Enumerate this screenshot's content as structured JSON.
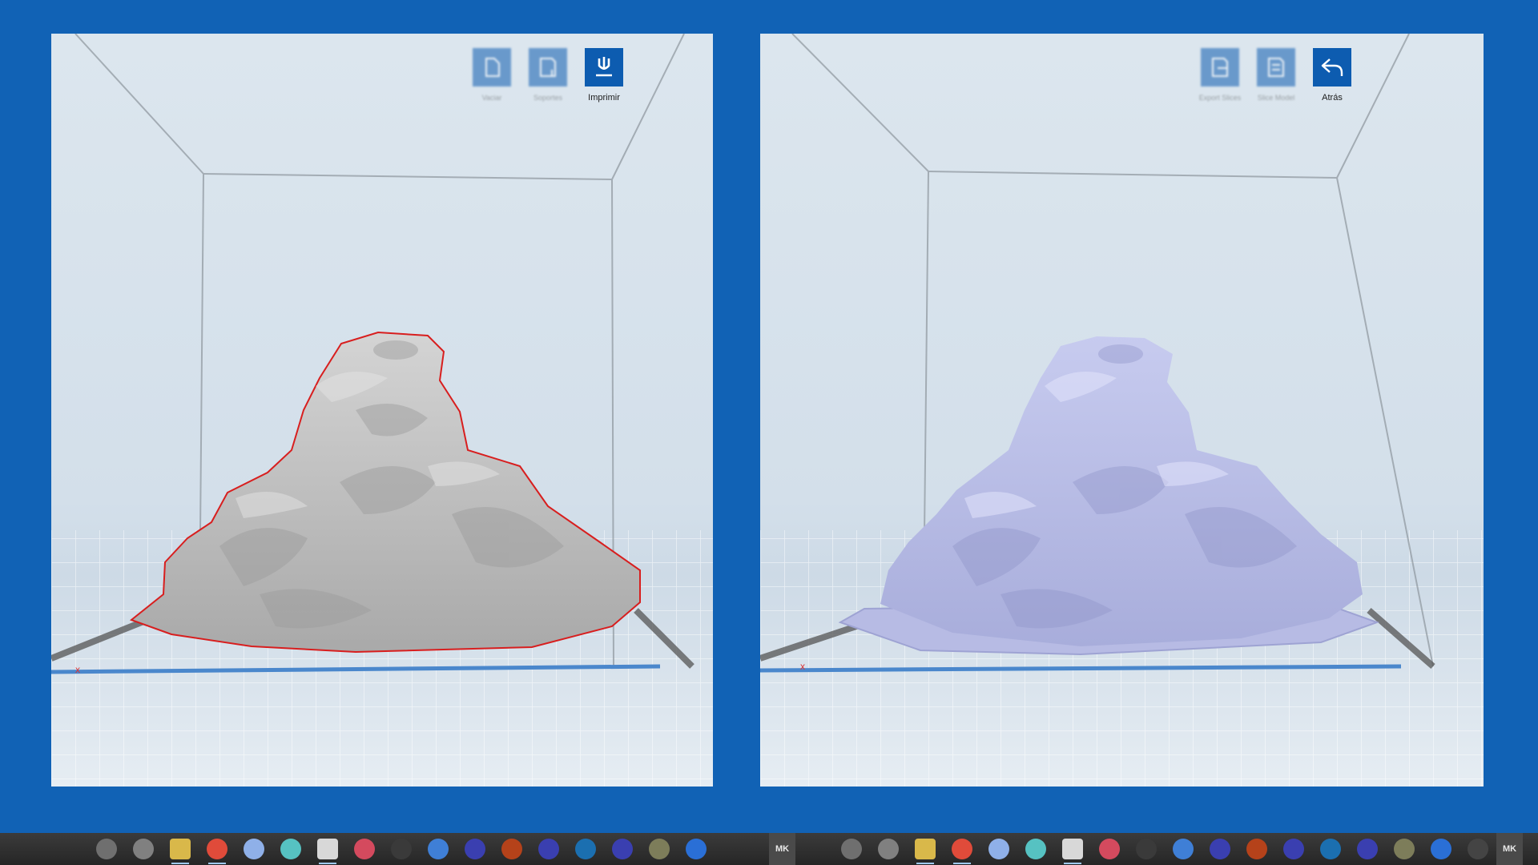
{
  "left_view": {
    "toolbar": [
      {
        "label": "Vaciar",
        "icon": "hollow-icon",
        "faded": true
      },
      {
        "label": "Soportes",
        "icon": "supports-icon",
        "faded": true
      },
      {
        "label": "Imprimir",
        "icon": "print-icon",
        "faded": false
      }
    ],
    "model_color": "#c4c4c4",
    "outline_color": "#d81e1e"
  },
  "right_view": {
    "toolbar": [
      {
        "label": "Export Slices",
        "icon": "export-slices-icon",
        "faded": true
      },
      {
        "label": "Slice Model",
        "icon": "slice-model-icon",
        "faded": true
      },
      {
        "label": "Atrás",
        "icon": "back-arrow-icon",
        "faded": false
      }
    ],
    "model_color": "#b9bde6"
  },
  "taskbar": {
    "left_icons": [
      "app-icon",
      "app-icon",
      "folder-icon",
      "chrome-icon",
      "app-icon",
      "app-icon",
      "notepad-icon",
      "app-icon",
      "app-icon",
      "app-icon",
      "app-icon",
      "app-icon",
      "app-icon",
      "app-icon",
      "app-icon",
      "app-icon",
      "slicer-icon"
    ],
    "right_icons": [
      "app-icon",
      "app-icon",
      "folder-icon",
      "chrome-icon",
      "app-icon",
      "app-icon",
      "notepad-icon",
      "app-icon",
      "app-icon",
      "app-icon",
      "app-icon",
      "app-icon",
      "app-icon",
      "app-icon",
      "app-icon",
      "app-icon",
      "app-icon",
      "slicer-icon"
    ],
    "label_left": "MK",
    "label_right": "MK"
  },
  "colors": {
    "background": "#1162b5",
    "button": "#0d5cb0",
    "taskbar": "#2e2e2e"
  }
}
